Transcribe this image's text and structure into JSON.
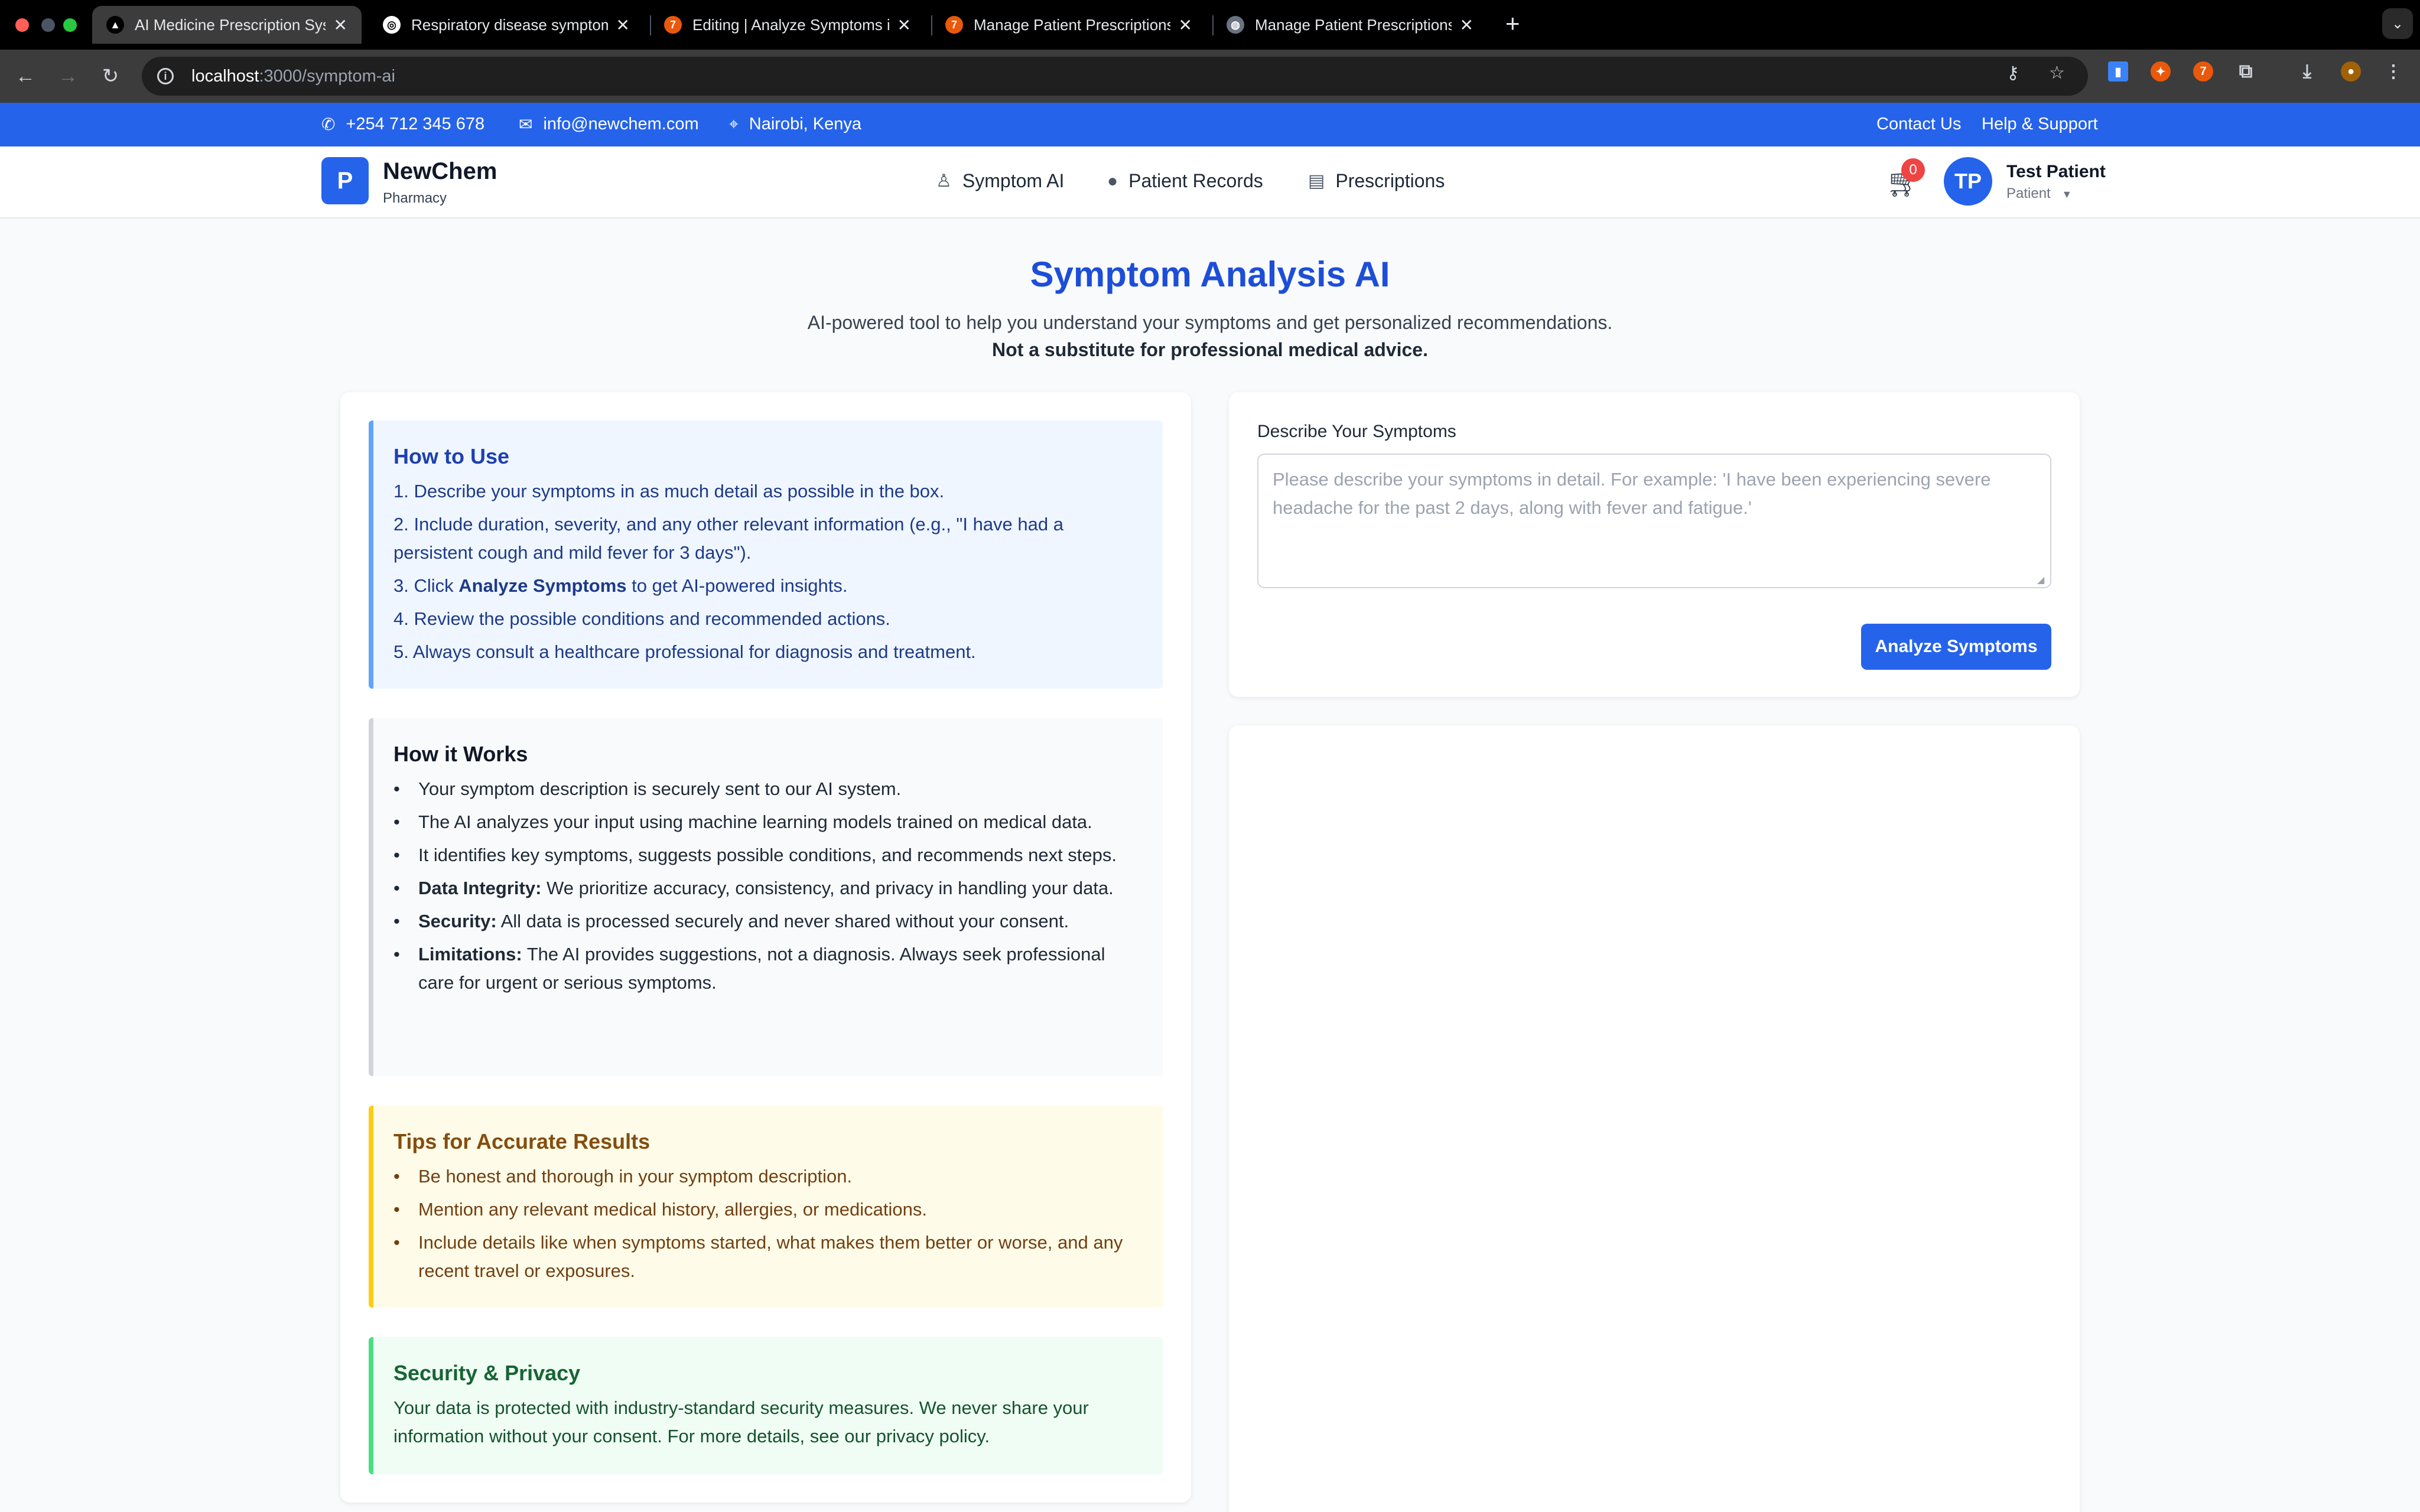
{
  "browser": {
    "tabs": [
      {
        "title": "AI Medicine Prescription Syst",
        "active": true
      },
      {
        "title": "Respiratory disease symptom",
        "active": false
      },
      {
        "title": "Editing | Analyze Symptoms i",
        "active": false
      },
      {
        "title": "Manage Patient Prescriptions",
        "active": false
      },
      {
        "title": "Manage Patient Prescriptions",
        "active": false
      }
    ],
    "url_host": "localhost",
    "url_path": ":3000/symptom-ai"
  },
  "topbar": {
    "phone": "+254 712 345 678",
    "email": "info@newchem.com",
    "location": "Nairobi, Kenya",
    "contact_link": "Contact Us",
    "help_link": "Help & Support"
  },
  "header": {
    "logo_letter": "P",
    "brand_name": "NewChem",
    "brand_sub": "Pharmacy",
    "nav": {
      "symptom_ai": "Symptom AI",
      "patient_records": "Patient Records",
      "prescriptions": "Prescriptions"
    },
    "cart_count": "0",
    "avatar_initials": "TP",
    "user_name": "Test Patient",
    "user_role": "Patient"
  },
  "page": {
    "title": "Symptom Analysis AI",
    "subtitle": "AI-powered tool to help you understand your symptoms and get personalized recommendations.",
    "disclaimer": "Not a substitute for professional medical advice."
  },
  "how_to_use": {
    "heading": "How to Use",
    "step1": "1. Describe your symptoms in as much detail as possible in the box.",
    "step2": "2. Include duration, severity, and any other relevant information (e.g., \"I have had a persistent cough and mild fever for 3 days\").",
    "step3_pre": "3. Click ",
    "step3_bold": "Analyze Symptoms",
    "step3_post": " to get AI-powered insights.",
    "step4": "4. Review the possible conditions and recommended actions.",
    "step5": "5. Always consult a healthcare professional for diagnosis and treatment."
  },
  "how_it_works": {
    "heading": "How it Works",
    "item1": "Your symptom description is securely sent to our AI system.",
    "item2": "The AI analyzes your input using machine learning models trained on medical data.",
    "item3": "It identifies key symptoms, suggests possible conditions, and recommends next steps.",
    "item4_bold": "Data Integrity:",
    "item4_text": " We prioritize accuracy, consistency, and privacy in handling your data.",
    "item5_bold": "Security:",
    "item5_text": " All data is processed securely and never shared without your consent.",
    "item6_bold": "Limitations:",
    "item6_text": " The AI provides suggestions, not a diagnosis. Always seek professional care for urgent or serious symptoms."
  },
  "tips": {
    "heading": "Tips for Accurate Results",
    "item1": "Be honest and thorough in your symptom description.",
    "item2": "Mention any relevant medical history, allergies, or medications.",
    "item3": "Include details like when symptoms started, what makes them better or worse, and any recent travel or exposures."
  },
  "privacy": {
    "heading": "Security & Privacy",
    "text": "Your data is protected with industry-standard security measures. We never share your information without your consent. For more details, see our privacy policy."
  },
  "form": {
    "label": "Describe Your Symptoms",
    "placeholder": "Please describe your symptoms in detail. For example: 'I have been experiencing severe headache for the past 2 days, along with fever and fatigue.'",
    "value": "",
    "submit_label": "Analyze Symptoms"
  },
  "colors": {
    "primary": "#2563eb",
    "title": "#1d4ed8",
    "badge": "#ef4444"
  }
}
